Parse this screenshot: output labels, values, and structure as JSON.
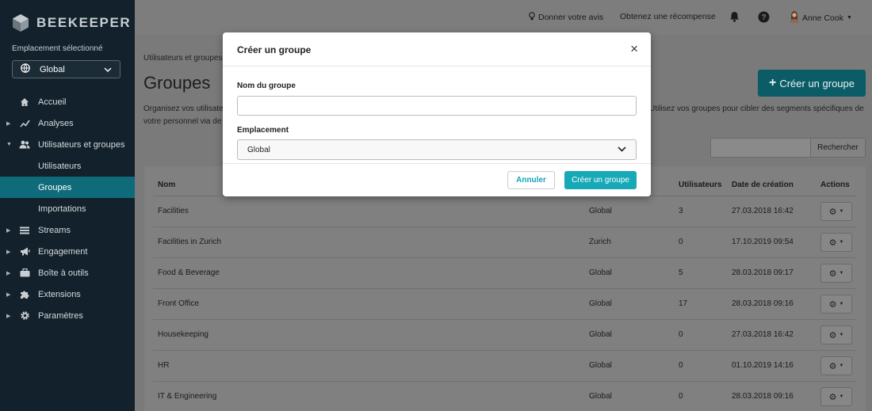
{
  "app": {
    "name": "BEEKEEPER"
  },
  "sidebar": {
    "location_label": "Emplacement sélectionné",
    "location_value": "Global",
    "items": [
      {
        "label": "Accueil"
      },
      {
        "label": "Analyses"
      },
      {
        "label": "Utilisateurs et groupes"
      },
      {
        "label": "Utilisateurs"
      },
      {
        "label": "Groupes"
      },
      {
        "label": "Importations"
      },
      {
        "label": "Streams"
      },
      {
        "label": "Engagement"
      },
      {
        "label": "Boîte à outils"
      },
      {
        "label": "Extensions"
      },
      {
        "label": "Paramètres"
      }
    ]
  },
  "topbar": {
    "feedback": "Donner votre avis",
    "reward": "Obtenez une récompense",
    "user": "Anne Cook"
  },
  "page": {
    "breadcrumb": "Utilisateurs et groupes",
    "title": "Groupes",
    "desc_left_1": "Organisez vos utilisate",
    "desc_left_2": "votre personnel via de",
    "desc_right": "Utilisez vos groupes pour cibler des segments spécifiques de",
    "create_button": "Créer un groupe",
    "search_button": "Rechercher"
  },
  "table": {
    "headers": [
      "Nom",
      "Utilisateurs",
      "Date de création",
      "Actions"
    ],
    "rows": [
      {
        "name": "Facilities",
        "location": "Global",
        "users": "3",
        "date": "27.03.2018 16:42"
      },
      {
        "name": "Facilities in Zurich",
        "location": "Zurich",
        "users": "0",
        "date": "17.10.2019 09:54"
      },
      {
        "name": "Food & Beverage",
        "location": "Global",
        "users": "5",
        "date": "28.03.2018 09:17"
      },
      {
        "name": "Front Office",
        "location": "Global",
        "users": "17",
        "date": "28.03.2018 09:16"
      },
      {
        "name": "Housekeeping",
        "location": "Global",
        "users": "0",
        "date": "27.03.2018 16:42"
      },
      {
        "name": "HR",
        "location": "Global",
        "users": "0",
        "date": "01.10.2019 14:16"
      },
      {
        "name": "IT & Engineering",
        "location": "Global",
        "users": "0",
        "date": "28.03.2018 09:16"
      }
    ]
  },
  "modal": {
    "title": "Créer un groupe",
    "name_label": "Nom du groupe",
    "name_value": "",
    "location_label": "Emplacement",
    "location_value": "Global",
    "cancel": "Annuler",
    "submit": "Créer un groupe"
  },
  "colors": {
    "sidebar_bg": "#12212b",
    "accent": "#17a9b7",
    "active_nav": "#0f6b7a"
  }
}
